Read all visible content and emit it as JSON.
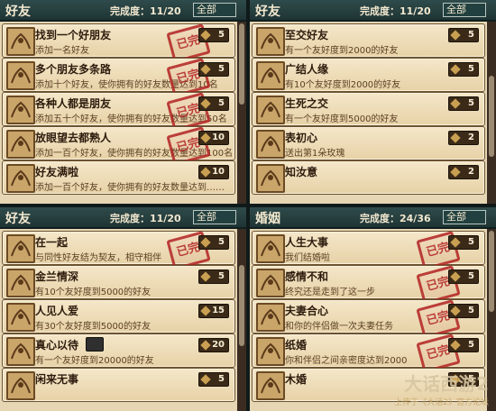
{
  "stamp_text": "已完成",
  "panels": [
    {
      "title": "好友",
      "progress": "完成度：11/20",
      "filter": "全部",
      "rows": [
        {
          "title": "找到一个好朋友",
          "desc": "添加一名好友",
          "reward": "5",
          "done": true
        },
        {
          "title": "多个朋友多条路",
          "desc": "添加十个好友，使你拥有的好友数量达到10名",
          "reward": "5",
          "done": true
        },
        {
          "title": "各种人都是朋友",
          "desc": "添加五十个好友，使你拥有的好友数量达到50名",
          "reward": "5",
          "done": true
        },
        {
          "title": "放眼望去都熟人",
          "desc": "添加一百个好友，使你拥有的好友数量达到100名",
          "reward": "10",
          "done": true
        },
        {
          "title": "好友满啦",
          "desc": "添加一百个好友，使你拥有的好友数量达到……",
          "reward": "10",
          "done": false
        }
      ]
    },
    {
      "title": "好友",
      "progress": "完成度：11/20",
      "filter": "全部",
      "rows": [
        {
          "title": "至交好友",
          "desc": "有一个友好度到2000的好友",
          "reward": "5",
          "done": false
        },
        {
          "title": "广结人缘",
          "desc": "有10个友好度到2000的好友",
          "reward": "5",
          "done": false
        },
        {
          "title": "生死之交",
          "desc": "有一个友好度到5000的好友",
          "reward": "5",
          "done": false
        },
        {
          "title": "表初心",
          "desc": "送出第1朵玫瑰",
          "reward": "2",
          "done": false
        },
        {
          "title": "知汝意",
          "desc": "",
          "reward": "2",
          "done": false
        }
      ]
    },
    {
      "title": "好友",
      "progress": "完成度：11/20",
      "filter": "全部",
      "rows": [
        {
          "title": "在一起",
          "desc": "与同性好友结为契友，相守相伴",
          "reward": "5",
          "done": true
        },
        {
          "title": "金兰情深",
          "desc": "有10个友好度到5000的好友",
          "reward": "5",
          "done": false
        },
        {
          "title": "人见人爱",
          "desc": "有30个友好度到5000的好友",
          "reward": "15",
          "done": false
        },
        {
          "title": "真心以待",
          "desc": "有一个友好度到20000的好友",
          "reward": "20",
          "done": false,
          "chest": true
        },
        {
          "title": "闲来无事",
          "desc": "",
          "reward": "5",
          "done": false
        }
      ]
    },
    {
      "title": "婚姻",
      "progress": "完成度：24/36",
      "filter": "全部",
      "rows": [
        {
          "title": "人生大事",
          "desc": "我们结婚啦",
          "reward": "5",
          "done": true
        },
        {
          "title": "感情不和",
          "desc": "终究还是走到了这一步",
          "reward": "5",
          "done": true
        },
        {
          "title": "夫妻合心",
          "desc": "和你的伴侣做一次夫妻任务",
          "reward": "5",
          "done": true
        },
        {
          "title": "纸婚",
          "desc": "你和伴侣之间亲密度达到2000",
          "reward": "5",
          "done": true
        },
        {
          "title": "木婚",
          "desc": "",
          "reward": "5",
          "done": false
        }
      ]
    }
  ],
  "watermark": {
    "logo": "大话西游2",
    "caption": "上传于《大话2》官方论坛"
  }
}
